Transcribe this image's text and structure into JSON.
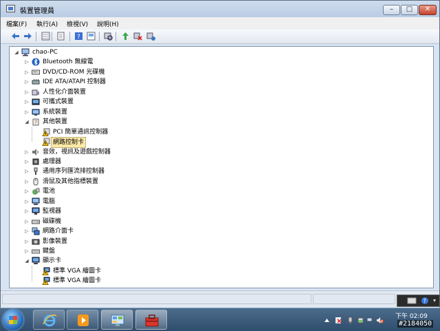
{
  "window": {
    "title": "裝置管理員",
    "controls": {
      "minimize": "–",
      "maximize": "□",
      "close": "✕"
    }
  },
  "menu": [
    "檔案(F)",
    "執行(A)",
    "檢視(V)",
    "說明(H)"
  ],
  "toolbar_icons": [
    "back-icon",
    "forward-icon",
    "properties-grid-icon",
    "properties-icon",
    "help-icon",
    "update-driver-icon",
    "scan-hardware-icon",
    "update-icon",
    "uninstall-icon",
    "enable-icon"
  ],
  "tree": {
    "root": "chao-PC",
    "categories": [
      {
        "label": "Bluetooth 無線電",
        "icon": "bluetooth-icon",
        "expanded": false
      },
      {
        "label": "DVD/CD-ROM 光碟機",
        "icon": "dvd-drive-icon",
        "expanded": false
      },
      {
        "label": "IDE ATA/ATAPI 控制器",
        "icon": "ide-controller-icon",
        "expanded": false
      },
      {
        "label": "人性化介面裝置",
        "icon": "hid-icon",
        "expanded": false
      },
      {
        "label": "可攜式裝置",
        "icon": "portable-device-icon",
        "expanded": false
      },
      {
        "label": "系統裝置",
        "icon": "system-device-icon",
        "expanded": false
      },
      {
        "label": "其他裝置",
        "icon": "other-devices-icon",
        "expanded": true,
        "children": [
          {
            "label": "PCI 簡單通訊控制器",
            "icon": "warning-device-icon"
          },
          {
            "label": "網路控制卡",
            "icon": "warning-device-icon",
            "selected": true
          }
        ]
      },
      {
        "label": "音效，視訊及遊戲控制器",
        "icon": "sound-icon",
        "expanded": false
      },
      {
        "label": "處理器",
        "icon": "processor-icon",
        "expanded": false
      },
      {
        "label": "通用序列匯流排控制器",
        "icon": "usb-icon",
        "expanded": false
      },
      {
        "label": "滑鼠及其他指標裝置",
        "icon": "mouse-icon",
        "expanded": false
      },
      {
        "label": "電池",
        "icon": "battery-icon",
        "expanded": false
      },
      {
        "label": "電腦",
        "icon": "computer-icon",
        "expanded": false
      },
      {
        "label": "監視器",
        "icon": "monitor-icon",
        "expanded": false
      },
      {
        "label": "磁碟機",
        "icon": "disk-drive-icon",
        "expanded": false
      },
      {
        "label": "網路介面卡",
        "icon": "network-adapter-icon",
        "expanded": false
      },
      {
        "label": "影像裝置",
        "icon": "imaging-device-icon",
        "expanded": false
      },
      {
        "label": "鍵盤",
        "icon": "keyboard-icon",
        "expanded": false
      },
      {
        "label": "顯示卡",
        "icon": "display-adapter-icon",
        "expanded": true,
        "children": [
          {
            "label": "標準 VGA 繪圖卡",
            "icon": "warning-display-icon"
          },
          {
            "label": "標準 VGA 繪圖卡",
            "icon": "warning-display-icon"
          }
        ]
      }
    ]
  },
  "taskbar": {
    "apps": [
      "internet-explorer-icon",
      "media-player-icon",
      "control-panel-icon",
      "toolbox-icon"
    ],
    "clock_time": "下午 02:09"
  },
  "watermark": "#2184050",
  "colors": {
    "selection": "#fce9a8",
    "taskbar": "#3a5a7a",
    "warning": "#f2c21b"
  }
}
